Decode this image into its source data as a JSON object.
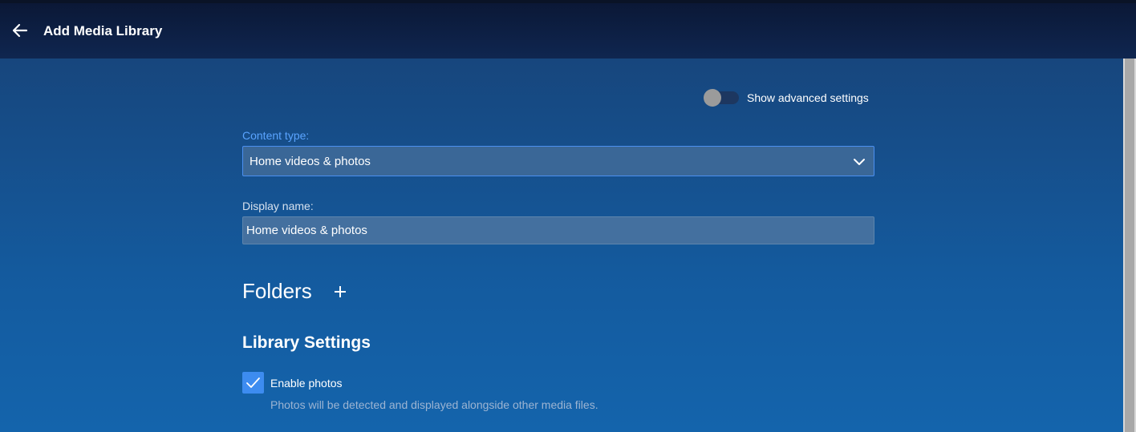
{
  "header": {
    "title": "Add Media Library"
  },
  "advanced_toggle": {
    "label": "Show advanced settings",
    "enabled": false
  },
  "content_type": {
    "label": "Content type:",
    "selected": "Home videos & photos"
  },
  "display_name": {
    "label": "Display name:",
    "value": "Home videos & photos"
  },
  "folders": {
    "title": "Folders"
  },
  "library_settings": {
    "title": "Library Settings",
    "enable_photos": {
      "label": "Enable photos",
      "description": "Photos will be detected and displayed alongside other media files.",
      "checked": true
    }
  },
  "icons": {
    "back": "arrow-left-icon",
    "dropdown": "chevron-down-icon",
    "add": "plus-icon",
    "check": "checkmark-icon"
  },
  "colors": {
    "header_bg": "#0f2650",
    "main_bg": "#145b9f",
    "accent": "#3d8cf0",
    "focused_label": "#5aa4ff"
  }
}
